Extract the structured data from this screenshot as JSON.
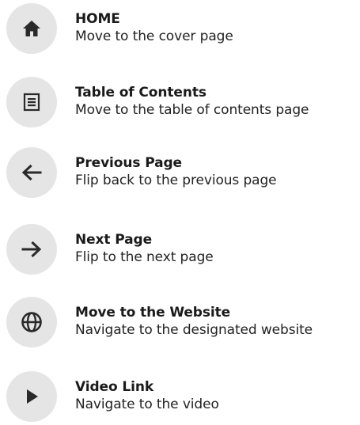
{
  "colors": {
    "icon_bg": "#e5e5e5",
    "icon_fg": "#2a2a2a",
    "text": "#1a1a1a"
  },
  "items": [
    {
      "icon": "home-icon",
      "title": "HOME",
      "description": "Move to the cover page"
    },
    {
      "icon": "table-of-contents-icon",
      "title": "Table of Contents",
      "description": "Move to the table of contents page"
    },
    {
      "icon": "arrow-left-icon",
      "title": "Previous Page",
      "description": "Flip back to the previous page"
    },
    {
      "icon": "arrow-right-icon",
      "title": "Next Page",
      "description": "Flip to the next page"
    },
    {
      "icon": "globe-icon",
      "title": "Move to the Website",
      "description": "Navigate to the designated website"
    },
    {
      "icon": "play-icon",
      "title": "Video Link",
      "description": "Navigate to the video"
    }
  ]
}
